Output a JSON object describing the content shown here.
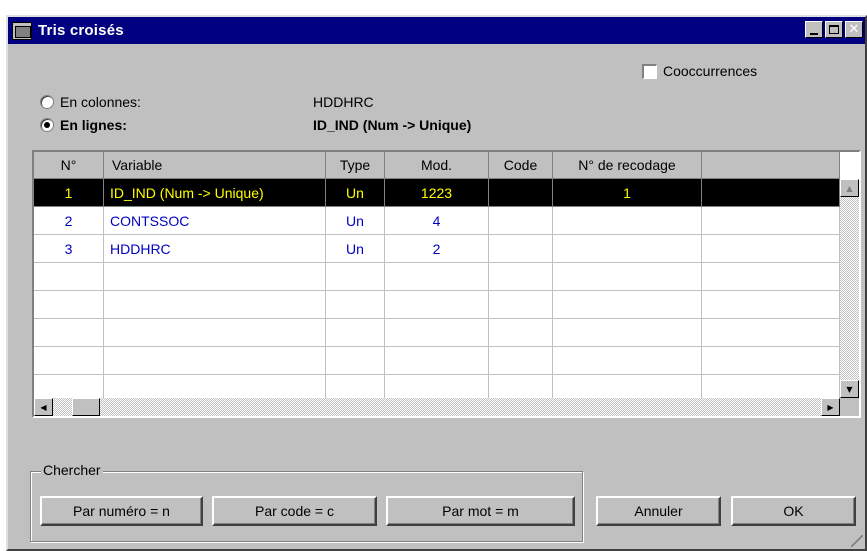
{
  "window": {
    "title": "Tris croisés",
    "title_bar_color": "#000080"
  },
  "options": {
    "cooccurrences_label": "Cooccurrences",
    "cooccurrences_checked": false
  },
  "orientation": {
    "columns_label": "En colonnes:",
    "columns_value": "HDDHRC",
    "rows_label": "En lignes:",
    "rows_value": "ID_IND (Num -> Unique)",
    "selected": "rows"
  },
  "table": {
    "headers": [
      "N°",
      "Variable",
      "Type",
      "Mod.",
      "Code",
      "N° de recodage",
      ""
    ],
    "rows": [
      [
        "1",
        "ID_IND (Num -> Unique)",
        "Un",
        "1223",
        "",
        "1",
        ""
      ],
      [
        "2",
        "CONTSSOC",
        "Un",
        "4",
        "",
        "",
        ""
      ],
      [
        "3",
        "HDDHRC",
        "Un",
        "2",
        "",
        "",
        ""
      ],
      [
        "",
        "",
        "",
        "",
        "",
        "",
        ""
      ],
      [
        "",
        "",
        "",
        "",
        "",
        "",
        ""
      ],
      [
        "",
        "",
        "",
        "",
        "",
        "",
        ""
      ],
      [
        "",
        "",
        "",
        "",
        "",
        "",
        ""
      ],
      [
        "",
        "",
        "",
        "",
        "",
        "",
        ""
      ]
    ],
    "selected_row": 0,
    "text_color": "#0000c0",
    "selected_text_color": "#ffff00"
  },
  "search": {
    "group_label": "Chercher",
    "by_number": "Par numéro = n",
    "by_code": "Par code = c",
    "by_word": "Par mot = m"
  },
  "actions": {
    "cancel": "Annuler",
    "ok": "OK"
  }
}
